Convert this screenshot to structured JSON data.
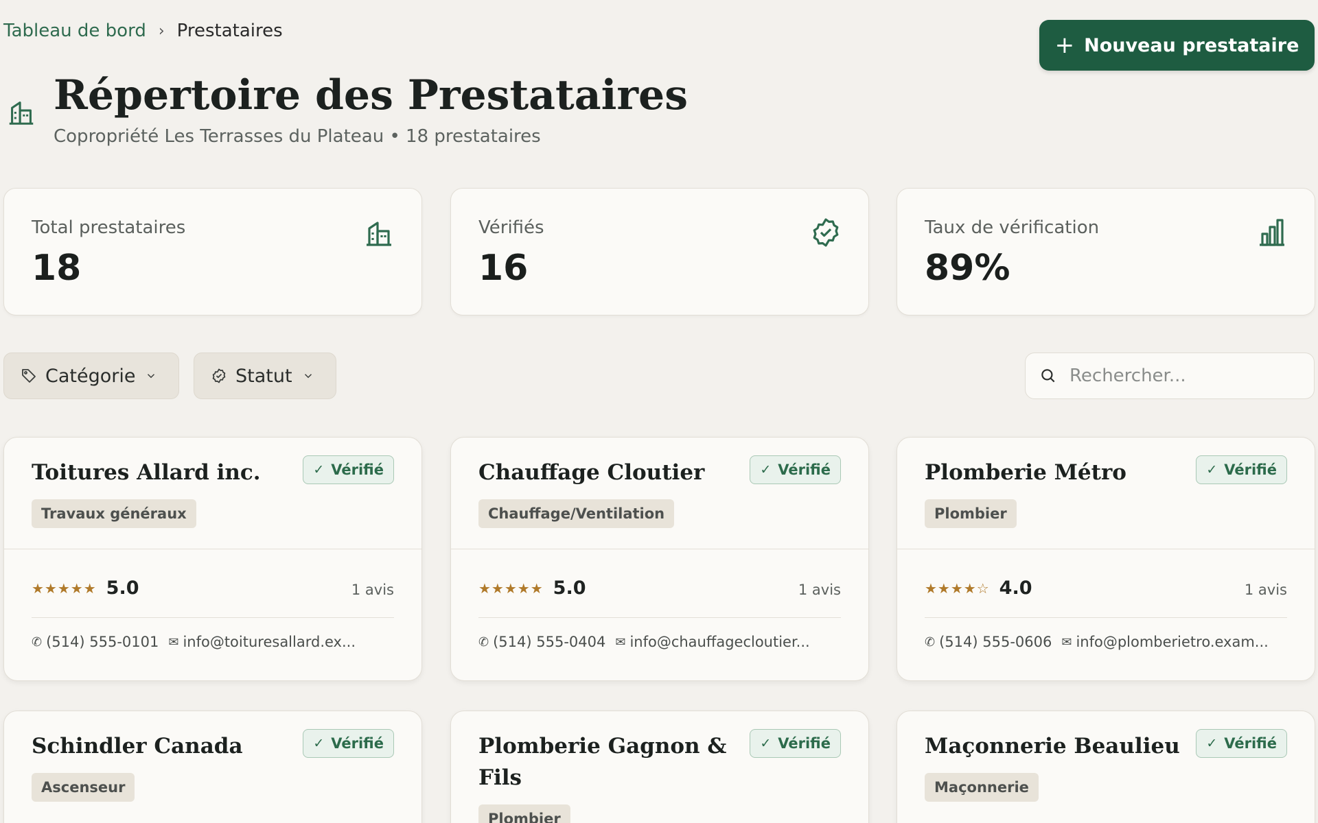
{
  "breadcrumb": {
    "parent": "Tableau de bord",
    "current": "Prestataires"
  },
  "header": {
    "new_button": "Nouveau prestataire",
    "title": "Répertoire des Prestataires",
    "subtitle": "Copropriété Les Terrasses du Plateau • 18 prestataires"
  },
  "stats": [
    {
      "label": "Total prestataires",
      "value": "18",
      "icon": "building-icon"
    },
    {
      "label": "Vérifiés",
      "value": "16",
      "icon": "verified-badge-icon"
    },
    {
      "label": "Taux de vérification",
      "value": "89%",
      "icon": "bar-chart-icon"
    }
  ],
  "filters": {
    "category": "Catégorie",
    "status": "Statut"
  },
  "search": {
    "placeholder": "Rechercher..."
  },
  "colors": {
    "accent": "#1e5c41",
    "star": "#b07a2a",
    "badge_bg": "#e9f2ec"
  },
  "providers": [
    {
      "name": "Toitures Allard inc.",
      "badge": "Vérifié",
      "category": "Travaux généraux",
      "stars": "★★★★★",
      "stars_filled": 5,
      "rating": "5.0",
      "reviews": "1 avis",
      "phone": "(514) 555-0101",
      "email": "info@toituresallard.ex..."
    },
    {
      "name": "Chauffage Cloutier",
      "badge": "Vérifié",
      "category": "Chauffage/Ventilation",
      "stars": "★★★★★",
      "stars_filled": 5,
      "rating": "5.0",
      "reviews": "1 avis",
      "phone": "(514) 555-0404",
      "email": "info@chauffagecloutier..."
    },
    {
      "name": "Plomberie Métro",
      "badge": "Vérifié",
      "category": "Plombier",
      "stars": "★★★★☆",
      "stars_filled": 4,
      "rating": "4.0",
      "reviews": "1 avis",
      "phone": "(514) 555-0606",
      "email": "info@plomberietro.exam..."
    },
    {
      "name": "Schindler Canada",
      "badge": "Vérifié",
      "category": "Ascenseur"
    },
    {
      "name": "Plomberie Gagnon & Fils",
      "badge": "Vérifié",
      "category": "Plombier"
    },
    {
      "name": "Maçonnerie Beaulieu",
      "badge": "Vérifié",
      "category": "Maçonnerie"
    }
  ]
}
